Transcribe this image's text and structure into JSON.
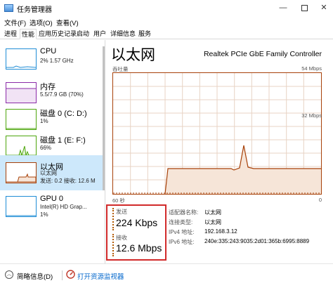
{
  "window": {
    "title": "任务管理器",
    "minimize_glyph": "—",
    "close_glyph": "✕"
  },
  "menu": [
    "文件(F)",
    "选项(O)",
    "查看(V)"
  ],
  "tabs": [
    {
      "label": "进程",
      "active": false
    },
    {
      "label": "性能",
      "active": true
    },
    {
      "label": "应用历史记录",
      "active": false
    },
    {
      "label": "启动",
      "active": false
    },
    {
      "label": "用户",
      "active": false
    },
    {
      "label": "详细信息",
      "active": false
    },
    {
      "label": "服务",
      "active": false
    }
  ],
  "sidebar": {
    "items": [
      {
        "name": "CPU",
        "sub1": "2% 1.57 GHz",
        "sub2": "",
        "color": "#1f8dd6",
        "icon": "cpu-graph-icon"
      },
      {
        "name": "内存",
        "sub1": "5.5/7.9 GB (70%)",
        "sub2": "",
        "color": "#8b2ba8",
        "icon": "memory-graph-icon"
      },
      {
        "name": "磁盘 0 (C: D:)",
        "sub1": "1%",
        "sub2": "",
        "color": "#4da60c",
        "icon": "disk0-graph-icon"
      },
      {
        "name": "磁盘 1 (E: F:)",
        "sub1": "66%",
        "sub2": "",
        "color": "#4da60c",
        "icon": "disk1-graph-icon"
      },
      {
        "name": "以太网",
        "sub1": "以太网",
        "sub2": "发送: 0.2 接收: 12.6 M",
        "color": "#a74109",
        "icon": "ethernet-graph-icon",
        "selected": true
      },
      {
        "name": "GPU 0",
        "sub1": "Intel(R) HD Grap...",
        "sub2": "1%",
        "color": "#1f8dd6",
        "icon": "gpu-graph-icon"
      }
    ]
  },
  "main": {
    "title": "以太网",
    "adapter": "Realtek PCIe GbE Family Controller",
    "throughput_label": "吞吐量",
    "max_label": "54 Mbps",
    "mid_label": "32 Mbps",
    "time_label": "60 秒",
    "zero_label": "0"
  },
  "stats": {
    "send_label": "发送",
    "send_value": "224 Kbps",
    "recv_label": "接收",
    "recv_value": "12.6 Mbps"
  },
  "properties": [
    {
      "label": "适配器名称:",
      "value": "以太网"
    },
    {
      "label": "连接类型:",
      "value": "以太网"
    },
    {
      "label": "IPv4 地址:",
      "value": "192.168.3.12"
    },
    {
      "label": "IPv6 地址:",
      "value": "240e:335:243:9035:2d01:365b:6995:8889"
    }
  ],
  "footer": {
    "fewer_details": "简略信息(D)",
    "open_monitor": "打开资源监视器"
  },
  "colors": {
    "accent": "#a74109",
    "selected_bg": "#cde8fb",
    "highlight": "#d12a2a",
    "link": "#0066cc"
  }
}
